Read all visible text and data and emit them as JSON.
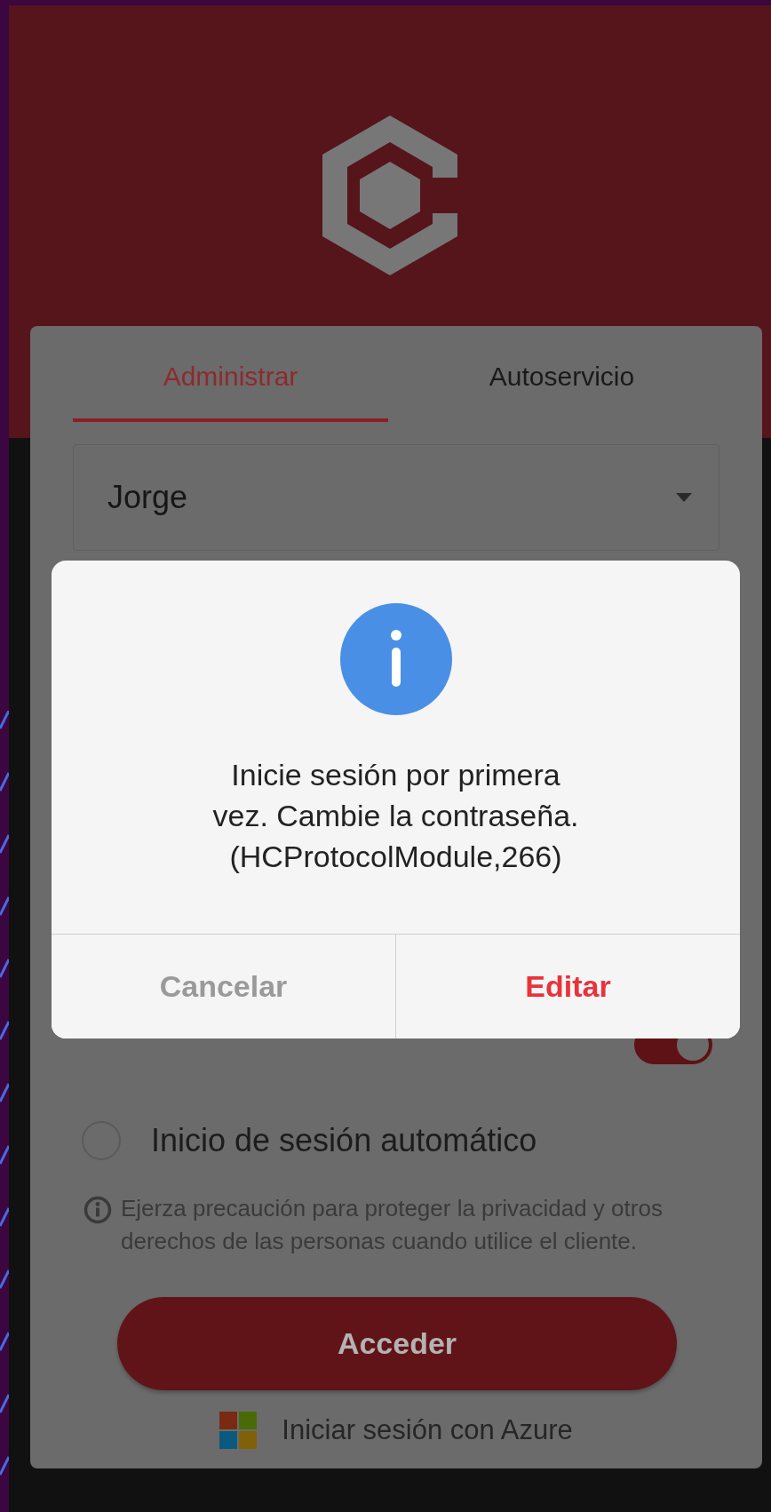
{
  "tabs": [
    {
      "label": "Administrar",
      "selected": true
    },
    {
      "label": "Autoservicio",
      "selected": false
    }
  ],
  "user_field": {
    "value": "Jorge"
  },
  "https_toggle": {
    "on": true
  },
  "auto_login": {
    "label": "Inicio de sesión automático",
    "checked": false
  },
  "privacy_note": "Ejerza precaución para proteger la privacidad y otros derechos de las personas cuando utilice el cliente.",
  "login_button": "Acceder",
  "azure_link": "Iniciar sesión con Azure",
  "dialog": {
    "message": "Inicie sesión por primera\nvez. Cambie la contraseña.\n(HCProtocolModule,266)",
    "buttons": [
      {
        "label": "Cancelar",
        "kind": "cancel"
      },
      {
        "label": "Editar",
        "kind": "confirm"
      }
    ]
  }
}
